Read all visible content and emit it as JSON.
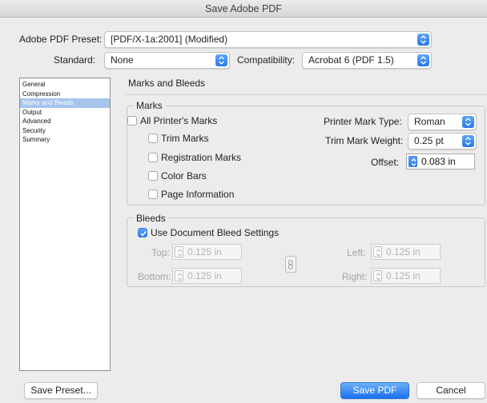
{
  "window": {
    "title": "Save Adobe PDF"
  },
  "header": {
    "preset_label": "Adobe PDF Preset:",
    "preset_value": "[PDF/X-1a:2001] (Modified)",
    "standard_label": "Standard:",
    "standard_value": "None",
    "compat_label": "Compatibility:",
    "compat_value": "Acrobat 6 (PDF 1.5)"
  },
  "sidebar": {
    "items": [
      {
        "label": "General"
      },
      {
        "label": "Compression"
      },
      {
        "label": "Marks and Bleeds"
      },
      {
        "label": "Output"
      },
      {
        "label": "Advanced"
      },
      {
        "label": "Security"
      },
      {
        "label": "Summary"
      }
    ],
    "selected_index": 2
  },
  "section": {
    "title": "Marks and Bleeds"
  },
  "marks": {
    "legend": "Marks",
    "all_printers_marks": {
      "label": "All Printer's Marks",
      "checked": false
    },
    "trim_marks": {
      "label": "Trim Marks",
      "checked": false
    },
    "registration_marks": {
      "label": "Registration Marks",
      "checked": false
    },
    "color_bars": {
      "label": "Color Bars",
      "checked": false
    },
    "page_information": {
      "label": "Page Information",
      "checked": false
    },
    "mark_type_label": "Printer Mark Type:",
    "mark_type_value": "Roman",
    "weight_label": "Trim Mark Weight:",
    "weight_value": "0.25 pt",
    "offset_label": "Offset:",
    "offset_value": "0.083 in"
  },
  "bleeds": {
    "legend": "Bleeds",
    "use_doc_label": "Use Document Bleed Settings",
    "use_doc_checked": true,
    "top_label": "Top:",
    "top_value": "0.125 in",
    "bottom_label": "Bottom:",
    "bottom_value": "0.125 in",
    "left_label": "Left:",
    "left_value": "0.125 in",
    "right_label": "Right:",
    "right_value": "0.125 in"
  },
  "footer": {
    "save_preset": "Save Preset...",
    "save_pdf": "Save PDF",
    "cancel": "Cancel"
  },
  "colors": {
    "accent": "#2a78ec",
    "selection": "#a6c4ec"
  },
  "icons": {
    "popup_arrow": "chevron-updown-icon",
    "stepper": "stepper-icon",
    "checkbox_check": "checkmark-icon",
    "link": "chain-link-icon"
  }
}
